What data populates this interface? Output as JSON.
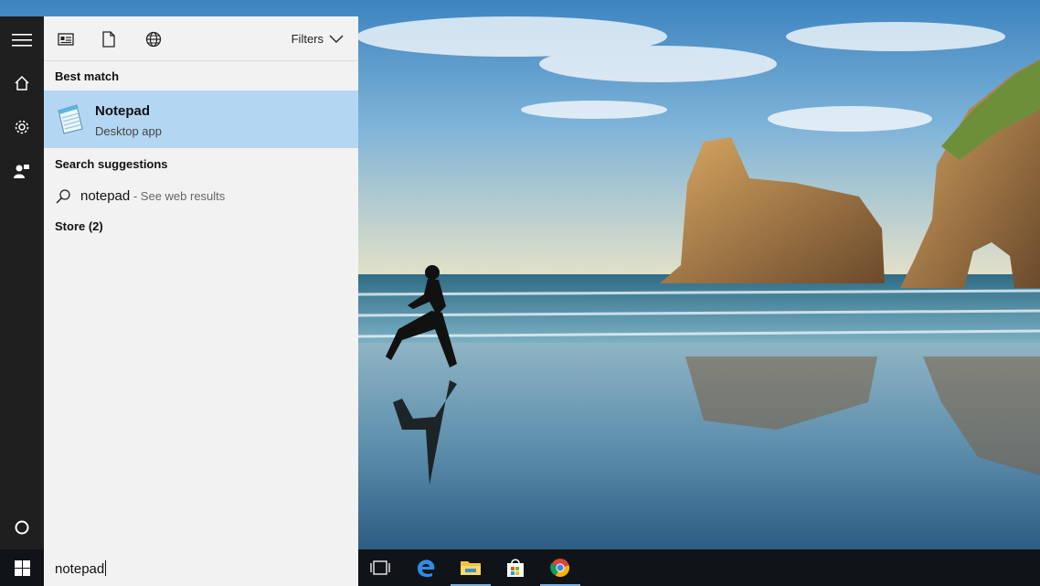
{
  "search": {
    "query": "notepad",
    "filters_label": "Filters"
  },
  "best_match": {
    "heading": "Best match",
    "app_name": "Notepad",
    "app_type": "Desktop app",
    "icon": "notepad-icon"
  },
  "suggestions": {
    "heading": "Search suggestions",
    "items": [
      {
        "text": "notepad",
        "hint": " - See web results",
        "icon": "search-icon"
      }
    ]
  },
  "store": {
    "heading": "Store (2)"
  },
  "rail_icons": [
    "hamburger-menu-icon",
    "home-icon",
    "settings-gear-icon",
    "user-feedback-icon",
    "cortana-circle-icon"
  ],
  "scope_icons": [
    "apps-scope-icon",
    "documents-scope-icon",
    "web-scope-icon"
  ],
  "taskbar_icons": [
    "windows-start-icon",
    "task-view-icon",
    "edge-icon",
    "file-explorer-icon",
    "store-icon",
    "chrome-icon"
  ],
  "colors": {
    "selection": "#b3d6f2",
    "panel_bg": "#f2f2f2",
    "rail_bg": "#1f1f1f",
    "taskbar_bg": "#101418"
  }
}
